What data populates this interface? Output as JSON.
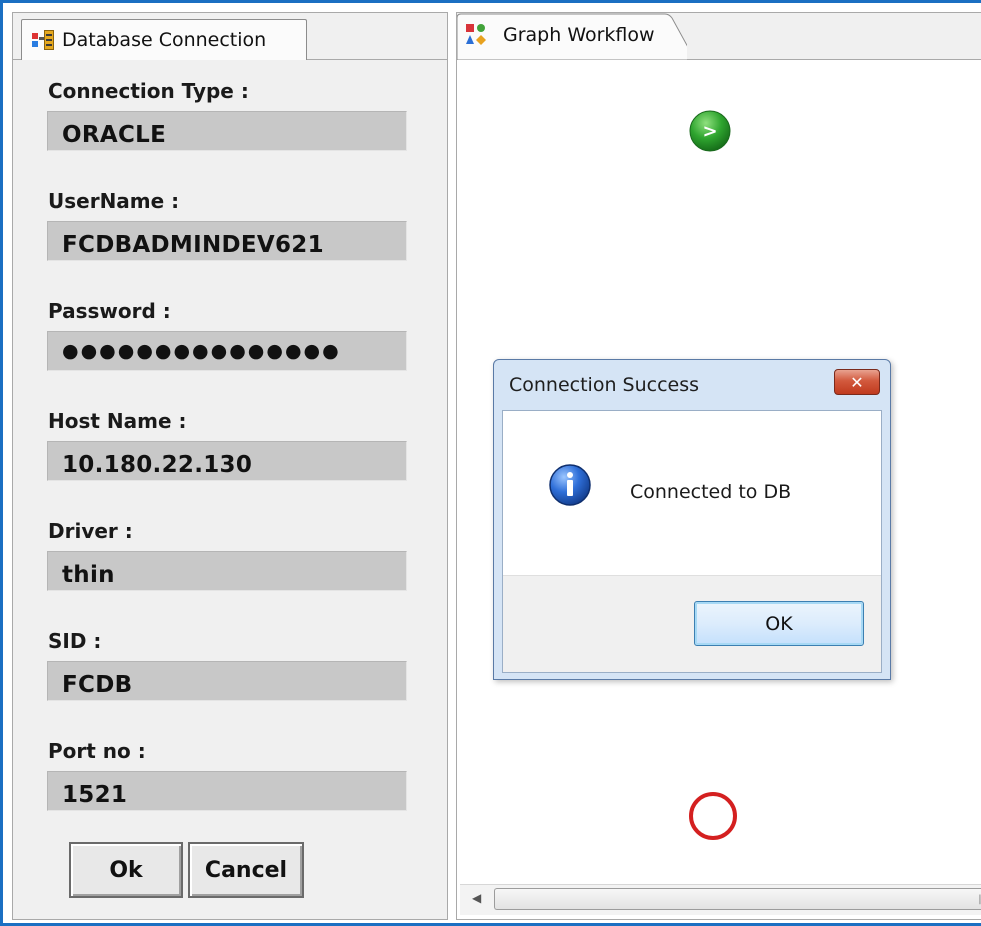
{
  "left_panel": {
    "tab_label": "Database Connection",
    "fields": [
      {
        "label": "Connection Type :",
        "value": "ORACLE"
      },
      {
        "label": "UserName :",
        "value": "FCDBADMINDEV621"
      },
      {
        "label": "Password :",
        "value": "●●●●●●●●●●●●●●●"
      },
      {
        "label": "Host Name :",
        "value": "10.180.22.130"
      },
      {
        "label": "Driver :",
        "value": "thin"
      },
      {
        "label": "SID :",
        "value": "FCDB"
      },
      {
        "label": "Port no :",
        "value": "1521"
      }
    ],
    "ok_label": "Ok",
    "cancel_label": "Cancel"
  },
  "right_panel": {
    "tab_label": "Graph Workflow",
    "start_node_glyph": ">"
  },
  "dialog": {
    "title": "Connection Success",
    "close_glyph": "✕",
    "message": "Connected to DB",
    "ok_label": "OK",
    "icon": "info-icon"
  },
  "colors": {
    "frame_accent": "#1b6fc2",
    "field_bg": "#c8c8c8",
    "start_node": "#2fa52f",
    "end_node": "#d42020",
    "dialog_close": "#c9452a"
  }
}
